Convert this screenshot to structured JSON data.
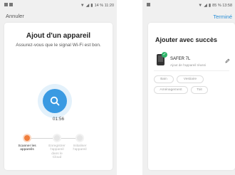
{
  "left_screen": {
    "status_bar": {
      "right_text": "14 % 11:20"
    },
    "nav": {
      "cancel_label": "Annuler"
    },
    "card": {
      "title": "Ajout d'un appareil",
      "subtitle": "Assurez-vous que le signal Wi-Fi est bon.",
      "timer": "01:56",
      "progress_fraction": 0.33
    },
    "steps": [
      {
        "label": "Scanner les appareils",
        "state": "active"
      },
      {
        "label": "Enregistrer l'appareil dans le Cloud",
        "state": "inactive"
      },
      {
        "label": "Initialiser l'appareil",
        "state": "inactive"
      }
    ]
  },
  "right_screen": {
    "status_bar": {
      "right_text": "85 % 13:58"
    },
    "nav": {
      "done_label": "Terminé"
    },
    "card": {
      "title": "Ajouter avec succès",
      "device_name": "SAFER 7L",
      "device_status": "Ajout de l'appareil réussi",
      "room_chips": [
        "Bain",
        "Vestiaire",
        "Aménagement",
        "Toit"
      ]
    }
  },
  "colors": {
    "accent_blue": "#3a9ae2",
    "step_active_orange": "#f07e3c",
    "success_green": "#2fb56a",
    "link_blue": "#2b8fd6"
  },
  "icons": {
    "scan": "magnifier-icon",
    "edit": "pencil-icon",
    "success": "check-icon"
  }
}
